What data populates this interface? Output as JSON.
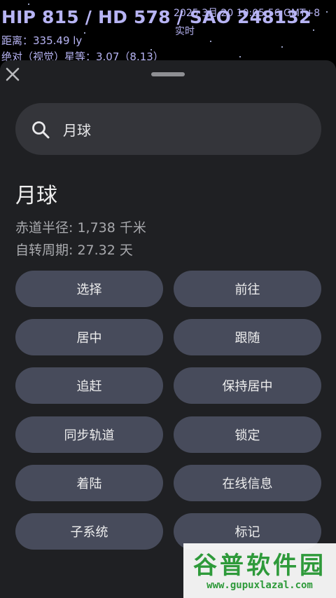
{
  "hud": {
    "object_designations": "HIP 815 / HD 578 / SAO 248132",
    "datetime": "2025 3月 20 10:05:56 GMT+8",
    "realtime_label": "实时",
    "distance": "距离：335.49 ly",
    "magnitude": "绝对（视觉）星等：3.07（8.13）"
  },
  "sheet": {
    "close_icon": "close-icon",
    "search": {
      "icon": "search-icon",
      "value": "月球"
    },
    "object": {
      "name": "月球",
      "radius": "赤道半径: 1,738 千米",
      "rotation": "自转周期: 27.32 天"
    },
    "actions": [
      "选择",
      "前往",
      "居中",
      "跟随",
      "追赶",
      "保持居中",
      "同步轨道",
      "锁定",
      "着陆",
      "在线信息",
      "子系统",
      "标记"
    ]
  },
  "watermark": {
    "text": "谷普软件园",
    "url": "www.gupuxlazal.com"
  },
  "colors": {
    "background": "#000000",
    "hud_text": "#b7b4f4",
    "sheet": "#1f2023",
    "search_field": "#34353a",
    "button": "#474b5b",
    "watermark": "#2e9a3a"
  }
}
